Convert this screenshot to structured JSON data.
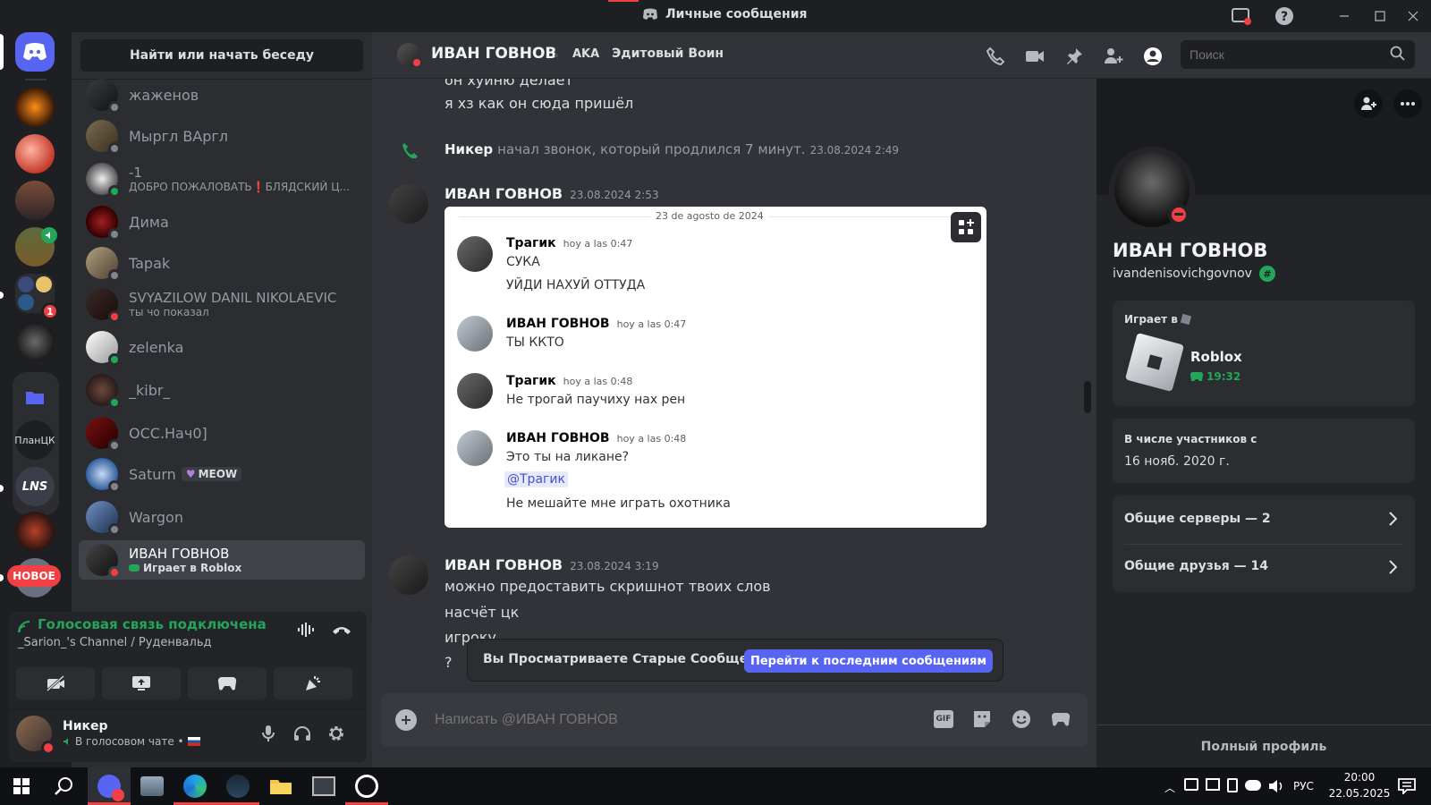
{
  "window": {
    "title": "Личные сообщения"
  },
  "servers": {
    "new_badge": "НОВОЕ",
    "folder_label": "ПланЦК",
    "notification_count": "1"
  },
  "dm_panel": {
    "search_label": "Найти или начать беседу",
    "items": [
      {
        "name": "жаженов",
        "sub": "",
        "status": "offline"
      },
      {
        "name": "Мыргл ВАргл",
        "sub": "",
        "status": "offline"
      },
      {
        "name": "-1",
        "sub": "ДОБРО ПОЖАЛОВАТЬ❗БЛЯДСКИЙ Ц...",
        "status": "online"
      },
      {
        "name": "Дима",
        "sub": "",
        "status": "offline"
      },
      {
        "name": "Tapak",
        "sub": "",
        "status": "offline"
      },
      {
        "name": "SVYAZILOW DANIL NIKOLAEVIC",
        "sub": "ты чо показал",
        "status": "dnd"
      },
      {
        "name": "zelenka",
        "sub": "",
        "status": "online"
      },
      {
        "name": "_kibr_",
        "sub": "",
        "status": "online"
      },
      {
        "name": "ОСС.Нач0]",
        "sub": "",
        "status": "offline"
      },
      {
        "name": "Saturn",
        "sub": "",
        "status": "offline",
        "tag": "MEOW"
      },
      {
        "name": "Wargon",
        "sub": "",
        "status": "offline"
      },
      {
        "name": "ИВАН ГОВНОВ",
        "sub": "Играет в Roblox",
        "status": "dnd",
        "selected": true
      }
    ]
  },
  "voice": {
    "status": "Голосовая связь подключена",
    "channel": "_Sarion_'s Channel / Руденвальд"
  },
  "user": {
    "name": "Никер",
    "status": "В голосовом чате •"
  },
  "header": {
    "name": "ИВАН ГОВНОВ",
    "aka_label": "AKA",
    "aka_value": "Эдитовый Воин",
    "search_placeholder": "Поиск"
  },
  "chat": {
    "lines_top": [
      "он хуйню делает",
      "я хз как он сюда пришёл"
    ],
    "call": {
      "name": "Никер",
      "text": "начал звонок, который продлился 7 минут.",
      "time": "23.08.2024 2:49"
    },
    "msg1": {
      "author": "ИВАН ГОВНОВ",
      "time": "23.08.2024 2:53"
    },
    "embed": {
      "date": "23 de agosto de 2024",
      "messages": [
        {
          "author": "Трагик",
          "time": "hoy a las 0:47",
          "lines": [
            "СУКА",
            "УЙДИ НАХУЙ ОТТУДА"
          ]
        },
        {
          "author": "ИВАН ГОВНОВ",
          "time": "hoy a las 0:47",
          "lines": [
            "ТЫ ККТО"
          ]
        },
        {
          "author": "Трагик",
          "time": "hoy a las 0:48",
          "lines": [
            "Не трогай паучиху нах рен"
          ]
        },
        {
          "author": "ИВАН ГОВНОВ",
          "time": "hoy a las 0:48",
          "lines": [
            "Это ты на ликане?"
          ],
          "mention": "@Трагик",
          "after": "Не мешайте мне играть охотника"
        }
      ]
    },
    "msg2": {
      "author": "ИВАН ГОВНОВ",
      "time": "23.08.2024 3:19",
      "lines": [
        "можно предоставить скришнот твоих слов",
        "насчёт цк",
        "игроку",
        "?"
      ]
    },
    "old_messages": {
      "text": "Вы Просматриваете Старые Сообщения",
      "button": "Перейти к последним сообщениям"
    },
    "input_placeholder": "Написать @ИВАН ГОВНОВ",
    "gif_label": "GIF"
  },
  "profile": {
    "name": "ИВАН ГОВНОВ",
    "username": "ivandenisovichgovnov",
    "playing_label": "Играет в",
    "game": "Roblox",
    "game_time": "19:32",
    "member_since_label": "В числе участников с",
    "member_since": "16 нояб. 2020 г.",
    "mutual_servers": "Общие серверы — 2",
    "mutual_friends": "Общие друзья — 14",
    "full_profile": "Полный профиль"
  },
  "taskbar": {
    "lang": "РУС",
    "time": "20:00",
    "date": "22.05.2025"
  },
  "colors": {
    "accent": "#5865f2",
    "green": "#23a55a",
    "red": "#f23f43",
    "gray": "#80848e"
  }
}
